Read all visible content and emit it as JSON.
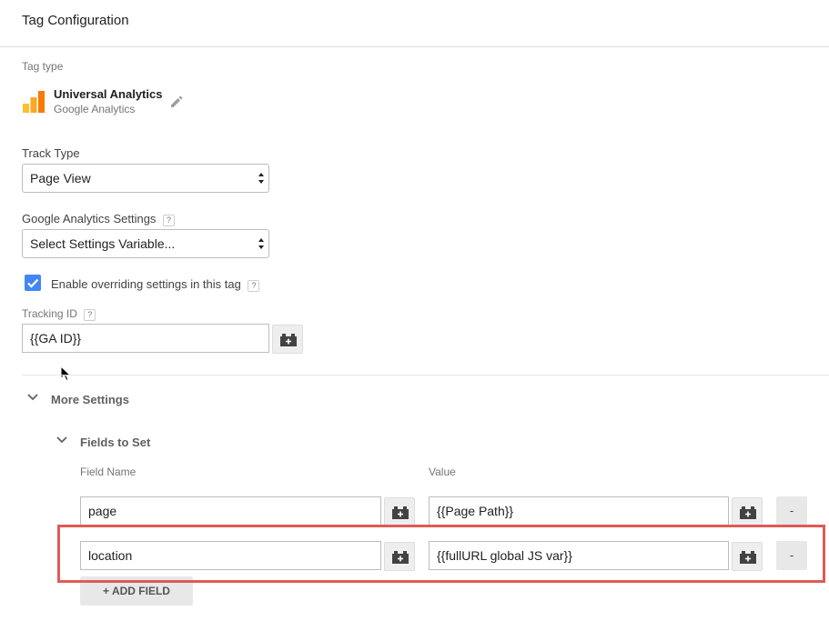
{
  "header": {
    "title": "Tag Configuration"
  },
  "tag_type": {
    "label": "Tag type",
    "name": "Universal Analytics",
    "subtitle": "Google Analytics",
    "icon": "universal-analytics-icon",
    "edit_icon": "pencil-icon"
  },
  "track_type": {
    "label": "Track Type",
    "value": "Page View"
  },
  "ga_settings": {
    "label": "Google Analytics Settings",
    "help": "?",
    "value": "Select Settings Variable..."
  },
  "override": {
    "label": "Enable overriding settings in this tag",
    "help": "?",
    "checked": true
  },
  "tracking_id": {
    "label": "Tracking ID",
    "help": "?",
    "value": "{{GA ID}}"
  },
  "more_settings": {
    "label": "More Settings"
  },
  "fields_to_set": {
    "label": "Fields to Set",
    "col_name": "Field Name",
    "col_value": "Value",
    "rows": [
      {
        "name": "page",
        "value": "{{Page Path}}",
        "remove": "-"
      },
      {
        "name": "location",
        "value": "{{fullURL global JS var}}",
        "remove": "-"
      }
    ],
    "add_label": "+ ADD FIELD"
  },
  "colors": {
    "accent": "#4285f4",
    "highlight": "#e05a57",
    "logo_orange": "#f57c00",
    "logo_yellow": "#fbc02d"
  }
}
